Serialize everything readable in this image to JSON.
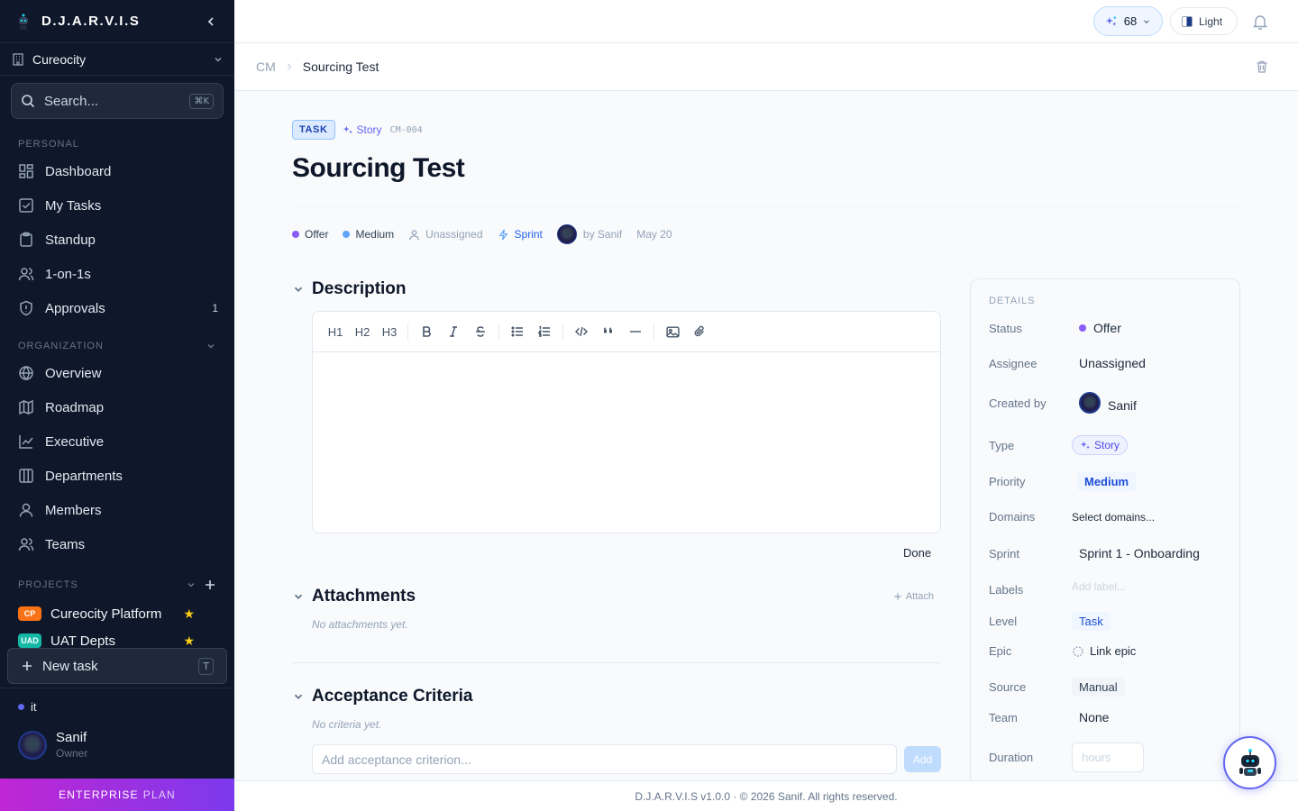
{
  "app": {
    "name": "D.J.A.R.V.I.S"
  },
  "workspace": {
    "name": "Cureocity"
  },
  "search": {
    "placeholder": "Search...",
    "shortcut": "⌘K"
  },
  "sidebar": {
    "personal_label": "PERSONAL",
    "personal_items": [
      {
        "label": "Dashboard",
        "icon": "dashboard-icon"
      },
      {
        "label": "My Tasks",
        "icon": "check-square-icon"
      },
      {
        "label": "Standup",
        "icon": "clipboard-icon"
      },
      {
        "label": "1-on-1s",
        "icon": "users-icon"
      },
      {
        "label": "Approvals",
        "icon": "shield-icon",
        "badge": "1"
      }
    ],
    "org_label": "ORGANIZATION",
    "org_items": [
      {
        "label": "Overview",
        "icon": "globe-icon"
      },
      {
        "label": "Roadmap",
        "icon": "map-icon"
      },
      {
        "label": "Executive",
        "icon": "line-chart-icon"
      },
      {
        "label": "Departments",
        "icon": "columns-icon"
      },
      {
        "label": "Members",
        "icon": "user-icon"
      },
      {
        "label": "Teams",
        "icon": "users-icon"
      }
    ],
    "projects_label": "PROJECTS",
    "projects": [
      {
        "code": "CP",
        "name": "Cureocity Platform",
        "color": "#f97316"
      },
      {
        "code": "UAD",
        "name": "UAT Depts",
        "color": "#14b8a6"
      }
    ],
    "new_task": {
      "label": "New task",
      "shortcut": "T"
    },
    "department": "it",
    "user": {
      "name": "Sanif",
      "role": "Owner"
    },
    "plan": {
      "tier": "ENTERPRISE",
      "suffix": "PLAN"
    }
  },
  "topbar": {
    "credits": "68",
    "theme_label": "Light"
  },
  "breadcrumb": {
    "project": "CM",
    "current": "Sourcing Test"
  },
  "task": {
    "kind_tag": "TASK",
    "type": "Story",
    "id": "CM-004",
    "title": "Sourcing Test",
    "meta": {
      "status": "Offer",
      "priority": "Medium",
      "assignee": "Unassigned",
      "sprint": "Sprint",
      "created_by": "by Sanif",
      "date": "May 20"
    }
  },
  "description": {
    "heading": "Description",
    "toolbar": [
      "H1",
      "H2",
      "H3"
    ],
    "done_label": "Done"
  },
  "attachments": {
    "heading": "Attachments",
    "action": "Attach",
    "empty": "No attachments yet."
  },
  "acceptance": {
    "heading": "Acceptance Criteria",
    "empty": "No criteria yet.",
    "placeholder": "Add acceptance criterion...",
    "add_label": "Add"
  },
  "details": {
    "title": "DETAILS",
    "status": {
      "label": "Status",
      "value": "Offer"
    },
    "assignee": {
      "label": "Assignee",
      "value": "Unassigned"
    },
    "created_by": {
      "label": "Created by",
      "value": "Sanif"
    },
    "type": {
      "label": "Type",
      "value": "Story"
    },
    "priority": {
      "label": "Priority",
      "value": "Medium"
    },
    "domains": {
      "label": "Domains",
      "value": "Select domains..."
    },
    "sprint": {
      "label": "Sprint",
      "value": "Sprint 1 - Onboarding"
    },
    "labels": {
      "label": "Labels",
      "value": "Add label..."
    },
    "level": {
      "label": "Level",
      "value": "Task"
    },
    "epic": {
      "label": "Epic",
      "value": "Link epic"
    },
    "source": {
      "label": "Source",
      "value": "Manual"
    },
    "team": {
      "label": "Team",
      "value": "None"
    },
    "duration": {
      "label": "Duration",
      "placeholder": "hours"
    }
  },
  "footer": {
    "text": "D.J.A.R.V.I.S v1.0.0 · © 2026 Sanif. All rights reserved."
  },
  "colors": {
    "sidebar_bg": "#0f172a",
    "accent": "#2563eb",
    "status_offer": "#8b5cf6",
    "priority_medium": "#60a5fa",
    "plan_gradient_start": "#c026d3",
    "plan_gradient_end": "#7c3aed"
  }
}
